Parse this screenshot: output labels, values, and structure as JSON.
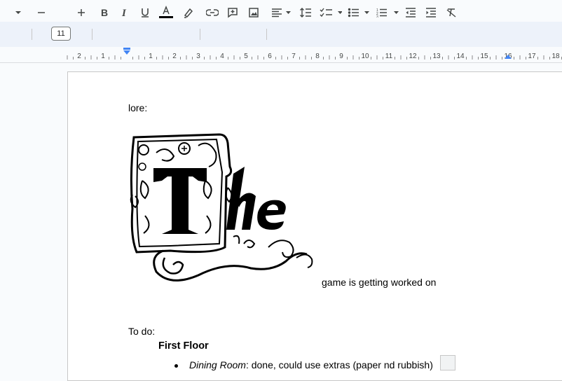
{
  "toolbar": {
    "font_size": "11",
    "icons": [
      "chevron-down-icon",
      "decrease-font-icon",
      "increase-font-icon",
      "bold-icon",
      "italic-icon",
      "underline-icon",
      "text-color-icon",
      "highlight-icon",
      "link-icon",
      "add-comment-icon",
      "insert-image-icon",
      "align-icon",
      "line-spacing-icon",
      "checklist-icon",
      "bulleted-list-icon",
      "numbered-list-icon",
      "decrease-indent-icon",
      "increase-indent-icon",
      "clear-formatting-icon"
    ],
    "text_color": "#000000"
  },
  "ruler": {
    "left_labels": [
      "2",
      "1"
    ],
    "labels": [
      "1",
      "2",
      "3",
      "4",
      "5",
      "6",
      "7",
      "8",
      "9",
      "10",
      "11",
      "12",
      "13",
      "14",
      "15",
      "16",
      "17",
      "18"
    ],
    "marker_color": "#4285f4"
  },
  "document": {
    "line1": "lore:",
    "decorative_image": "The",
    "caption": "game is getting worked on",
    "todo_label": "To do:",
    "heading": "First Floor",
    "bullet_italic": "Dining Room",
    "bullet_rest": ": done, could use extras (paper nd rubbish)"
  }
}
